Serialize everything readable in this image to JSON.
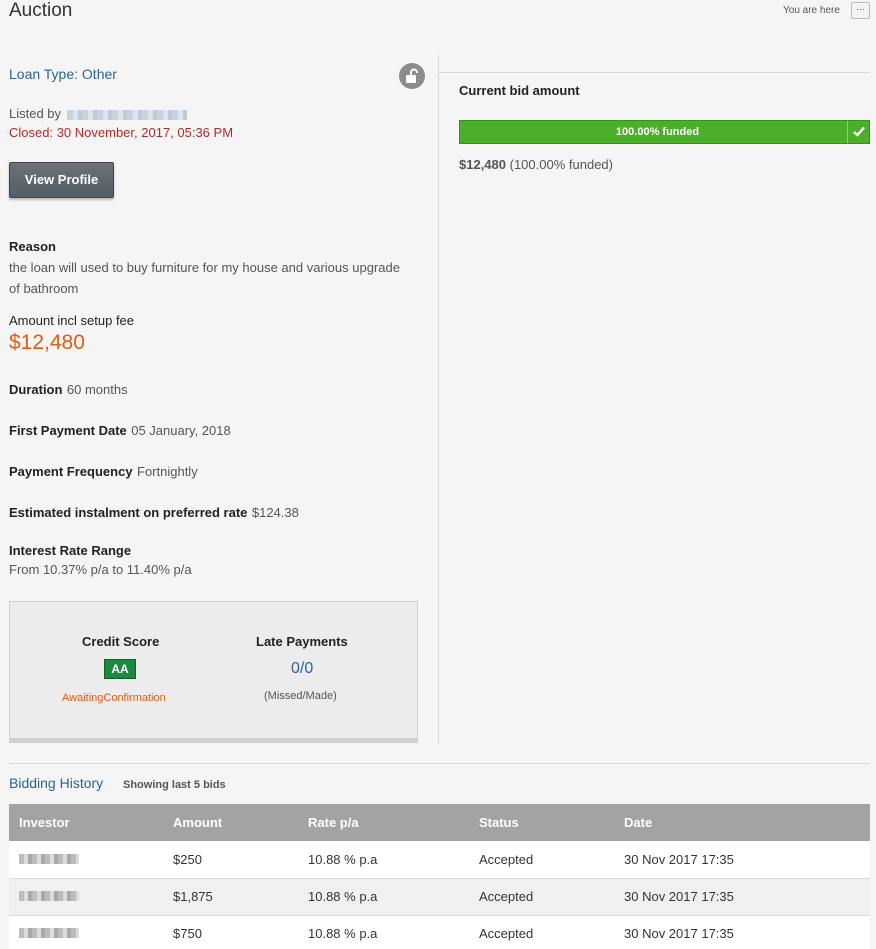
{
  "header": {
    "title": "Auction",
    "you_are_here": "You are here",
    "more_label": "···"
  },
  "loan": {
    "type_label": "Loan Type: Other",
    "listed_by_label": "Listed by",
    "closed_text": "Closed: 30 November, 2017, 05:36 PM",
    "view_profile_label": "View Profile",
    "reason_title": "Reason",
    "reason_text": "the loan will used to buy furniture for my house and various upgrade of bathroom",
    "amount_title": "Amount incl setup fee",
    "amount_value": "$12,480",
    "duration_label": "Duration",
    "duration_value": "60 months",
    "first_payment_label": "First Payment Date",
    "first_payment_value": "05 January, 2018",
    "frequency_label": "Payment Frequency",
    "frequency_value": "Fortnightly",
    "instalment_label": "Estimated instalment on preferred rate",
    "instalment_value": "$124.38",
    "rate_title": "Interest Rate Range",
    "rate_value": "From 10.37% p/a to 11.40% p/a"
  },
  "score": {
    "credit_title": "Credit Score",
    "credit_grade": "AA",
    "credit_status": "AwaitingConfirmation",
    "late_title": "Late Payments",
    "late_value": "0/0",
    "late_sub": "(Missed/Made)"
  },
  "bid": {
    "title": "Current bid amount",
    "progress_label": "100.00% funded",
    "progress_fraction": 1.0,
    "summary_amount": "$12,480",
    "summary_note": "(100.00% funded)"
  },
  "history": {
    "title": "Bidding History",
    "subtitle": "Showing last 5 bids",
    "columns": [
      "Investor",
      "Amount",
      "Rate p/a",
      "Status",
      "Date"
    ],
    "rows": [
      {
        "amount": "$250",
        "rate": "10.88 % p.a",
        "status": "Accepted",
        "date": "30 Nov 2017 17:35"
      },
      {
        "amount": "$1,875",
        "rate": "10.88 % p.a",
        "status": "Accepted",
        "date": "30 Nov 2017 17:35"
      },
      {
        "amount": "$750",
        "rate": "10.88 % p.a",
        "status": "Accepted",
        "date": "30 Nov 2017 17:35"
      }
    ]
  },
  "colors": {
    "accent_blue": "#2d6391",
    "amount_orange": "#e35b14",
    "closed_red": "#b22a2a",
    "funded_green": "#4caf2a",
    "badge_green": "#1b8a3e"
  }
}
